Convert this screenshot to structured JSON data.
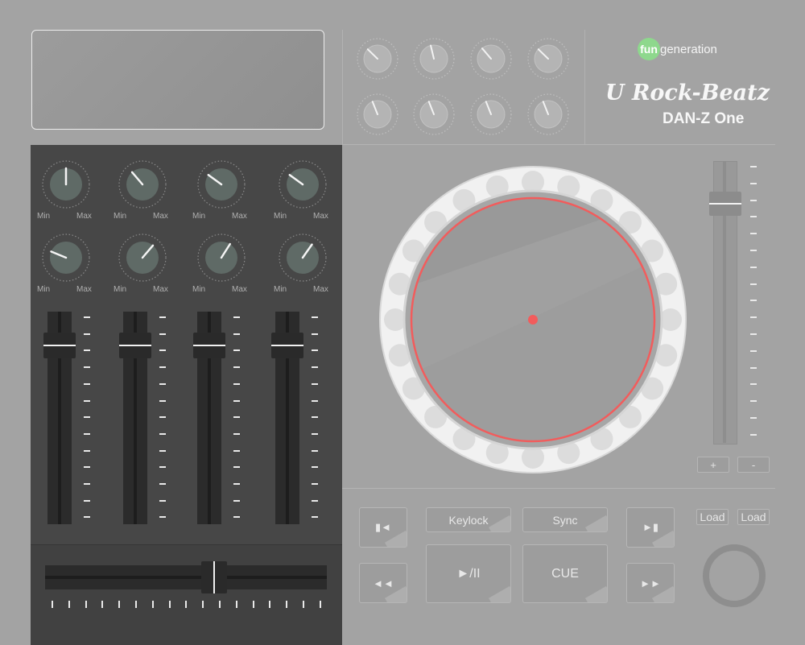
{
  "brand": {
    "fun": "fun",
    "generation": "generation",
    "logo_color": "#8ed88d"
  },
  "model": {
    "name": "U Rock-Beatz",
    "subtitle": "DAN-Z One"
  },
  "eq_knobs": {
    "min_label": "Min",
    "max_label": "Max",
    "rows": [
      [
        0.5,
        0.35,
        0.3,
        0.3
      ],
      [
        0.25,
        0.65,
        0.62,
        0.63
      ]
    ]
  },
  "top_knobs": [
    0.33,
    0.45,
    0.35,
    0.33,
    0.42,
    0.42,
    0.42,
    0.42
  ],
  "channel_faders": [
    0.84,
    0.84,
    0.84,
    0.84
  ],
  "crossfader": {
    "position": 0.6
  },
  "pitch": {
    "position": 0.85,
    "plus_label": "+",
    "minus_label": "-"
  },
  "jog": {
    "marker_color": "#f25c5c"
  },
  "buttons": {
    "keylock": "Keylock",
    "sync": "Sync",
    "play_pause": "►/II",
    "cue": "CUE",
    "load_left": "Load",
    "load_right": "Load",
    "prev_track": "▮◄",
    "next_track": "►▮",
    "rewind": "◄◄",
    "fast_forward": "►►"
  }
}
